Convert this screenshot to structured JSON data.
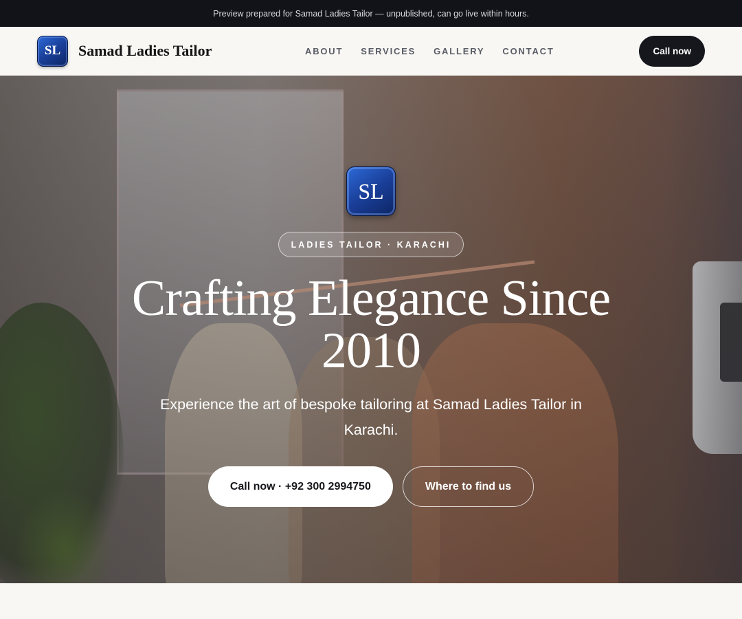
{
  "preview_bar": {
    "text": "Preview prepared for Samad Ladies Tailor — unpublished, can go live within hours."
  },
  "header": {
    "logo_text": "SL",
    "brand_name": "Samad Ladies Tailor",
    "nav": [
      {
        "label": "ABOUT"
      },
      {
        "label": "SERVICES"
      },
      {
        "label": "GALLERY"
      },
      {
        "label": "CONTACT"
      }
    ],
    "call_button": "Call now"
  },
  "hero": {
    "logo_text": "SL",
    "pill": "LADIES TAILOR · KARACHI",
    "title": "Crafting Elegance Since 2010",
    "subtitle": "Experience the art of bespoke tailoring at Samad Ladies Tailor in Karachi.",
    "primary_cta": "Call now · +92 300 2994750",
    "secondary_cta": "Where to find us"
  },
  "colors": {
    "topbar": "#111318",
    "accent_dark": "#15171c",
    "logo_blue": "#1a3f99",
    "page_bg": "#f8f7f4"
  }
}
